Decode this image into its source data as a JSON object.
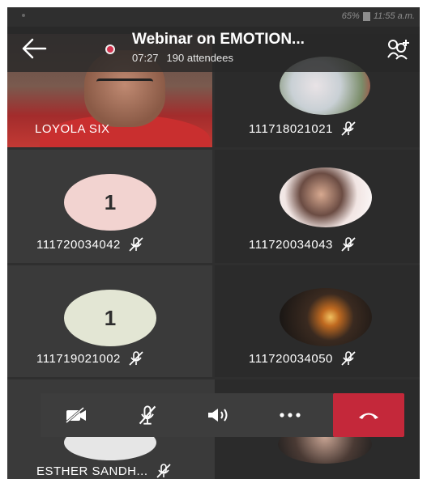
{
  "status": {
    "battery": "65%",
    "time": "11:55 a.m."
  },
  "header": {
    "title": "Webinar on EMOTION...",
    "duration": "07:27",
    "attendees": "190 attendees",
    "icons": {
      "back": "back-arrow-icon",
      "recording": "recording-dot-icon",
      "participants": "participants-icon"
    }
  },
  "participants": [
    {
      "name": "LOYOLA SIX",
      "type": "video",
      "muted": false
    },
    {
      "name": "111718021021",
      "type": "photo",
      "muted": true
    },
    {
      "name": "111720034042",
      "type": "initial",
      "initial": "1",
      "muted": true,
      "color": "#f2d3d0"
    },
    {
      "name": "111720034043",
      "type": "photo",
      "muted": true
    },
    {
      "name": "111719021002",
      "type": "initial",
      "initial": "1",
      "muted": true,
      "color": "#e3e6d4"
    },
    {
      "name": "111720034050",
      "type": "photo",
      "muted": true
    },
    {
      "name": "ESTHER SANDH...",
      "type": "photo",
      "muted": true
    },
    {
      "name": "",
      "type": "photo",
      "muted": true
    }
  ],
  "controls": {
    "icons": [
      "camera-off-icon",
      "mic-off-icon",
      "speaker-icon",
      "more-icon",
      "hang-up-icon"
    ]
  },
  "colors": {
    "accent": "#c4283a",
    "background": "#2f2f2f",
    "tile": "#3a3a3a"
  }
}
